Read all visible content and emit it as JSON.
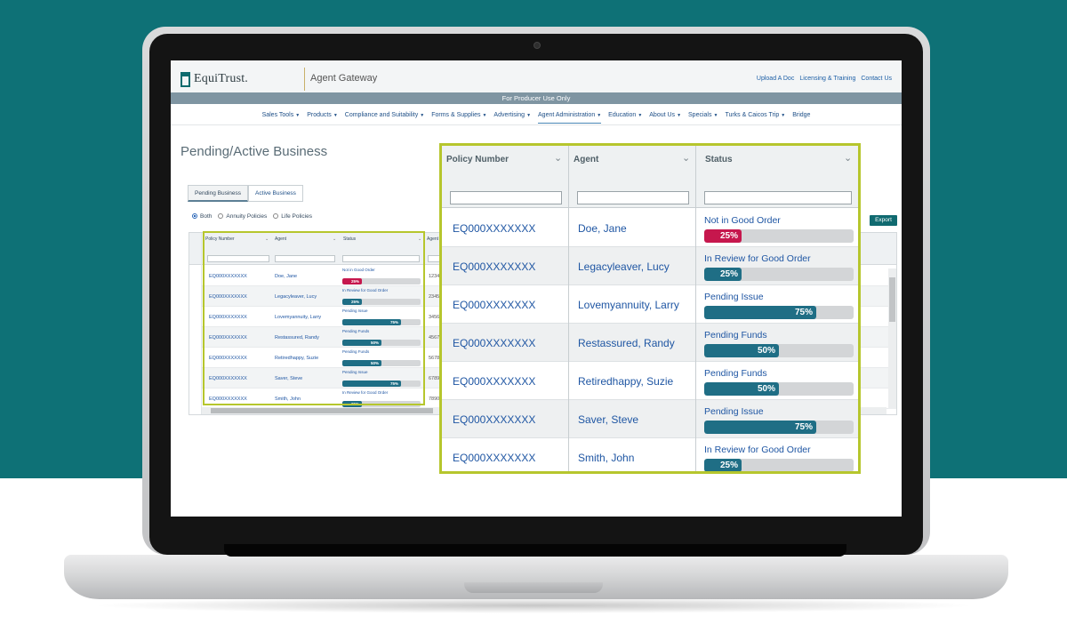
{
  "header": {
    "logo_text": "EquiTrust.",
    "app_title": "Agent Gateway",
    "links": [
      "Upload A Doc",
      "Licensing & Training",
      "Contact Us"
    ],
    "producer_bar": "For Producer Use Only"
  },
  "nav": {
    "items": [
      {
        "label": "Sales Tools",
        "has_menu": true
      },
      {
        "label": "Products",
        "has_menu": true
      },
      {
        "label": "Compliance and Suitability",
        "has_menu": true
      },
      {
        "label": "Forms & Supplies",
        "has_menu": true
      },
      {
        "label": "Advertising",
        "has_menu": true
      },
      {
        "label": "Agent Administration",
        "has_menu": true,
        "active": true
      },
      {
        "label": "Education",
        "has_menu": true
      },
      {
        "label": "About Us",
        "has_menu": true
      },
      {
        "label": "Specials",
        "has_menu": true
      },
      {
        "label": "Turks & Caicos Trip",
        "has_menu": true
      },
      {
        "label": "Bridge",
        "has_menu": false
      }
    ]
  },
  "page": {
    "title": "Pending/Active Business",
    "tabs": [
      "Pending Business",
      "Active Business"
    ],
    "filters": [
      "Both",
      "Annuity Policies",
      "Life Policies"
    ],
    "export_label": "Export"
  },
  "grid": {
    "columns": [
      "Policy Number",
      "Agent",
      "Status",
      "Agent N"
    ],
    "rows": [
      {
        "policy": "EQ000XXXXXXX",
        "agent": "Doe, Jane",
        "status": "Not in Good Order",
        "percent": 25,
        "pct_label": "25%",
        "agent_num": "1234",
        "color": "#c6174d"
      },
      {
        "policy": "EQ000XXXXXXX",
        "agent": "Legacyleaver, Lucy",
        "status": "In Review for Good Order",
        "percent": 25,
        "pct_label": "25%",
        "agent_num": "2345",
        "color": "#1f6e85"
      },
      {
        "policy": "EQ000XXXXXXX",
        "agent": "Lovemyannuity, Larry",
        "status": "Pending Issue",
        "percent": 75,
        "pct_label": "75%",
        "agent_num": "3456",
        "color": "#1f6e85"
      },
      {
        "policy": "EQ000XXXXXXX",
        "agent": "Restassured, Randy",
        "status": "Pending Funds",
        "percent": 50,
        "pct_label": "50%",
        "agent_num": "4567",
        "color": "#1f6e85"
      },
      {
        "policy": "EQ000XXXXXXX",
        "agent": "Retiredhappy, Suzie",
        "status": "Pending Funds",
        "percent": 50,
        "pct_label": "50%",
        "agent_num": "5678",
        "color": "#1f6e85"
      },
      {
        "policy": "EQ000XXXXXXX",
        "agent": "Saver, Steve",
        "status": "Pending Issue",
        "percent": 75,
        "pct_label": "75%",
        "agent_num": "6789",
        "color": "#1f6e85"
      },
      {
        "policy": "EQ000XXXXXXX",
        "agent": "Smith, John",
        "status": "In Review for Good Order",
        "percent": 25,
        "pct_label": "25%",
        "agent_num": "7890",
        "color": "#1f6e85"
      }
    ]
  },
  "colors": {
    "teal_background": "#0e7176",
    "highlight": "#b6c62d",
    "progress_teal": "#1f6e85",
    "progress_red": "#c6174d"
  }
}
